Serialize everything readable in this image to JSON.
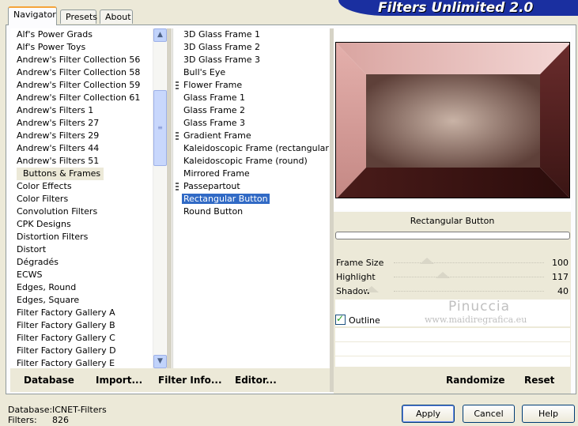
{
  "tabs": [
    {
      "label": "Navigator"
    },
    {
      "label": "Presets"
    },
    {
      "label": "About"
    }
  ],
  "banner": "Filters Unlimited 2.0",
  "categories": [
    "Alf's Power Grads",
    "Alf's Power Toys",
    "Andrew's Filter Collection 56",
    "Andrew's Filter Collection 58",
    "Andrew's Filter Collection 59",
    "Andrew's Filter Collection 61",
    "Andrew's Filters 1",
    "Andrew's Filters 27",
    "Andrew's Filters 29",
    "Andrew's Filters 44",
    "Andrew's Filters 51",
    "Buttons & Frames",
    "Color Effects",
    "Color Filters",
    "Convolution Filters",
    "CPK Designs",
    "Distortion Filters",
    "Distort",
    "Dégradés",
    "ECWS",
    "Edges, Round",
    "Edges, Square",
    "Filter Factory Gallery A",
    "Filter Factory Gallery B",
    "Filter Factory Gallery C",
    "Filter Factory Gallery D",
    "Filter Factory Gallery E"
  ],
  "filters": [
    {
      "label": "3D Glass Frame 1",
      "marked": false
    },
    {
      "label": "3D Glass Frame 2",
      "marked": false
    },
    {
      "label": "3D Glass Frame 3",
      "marked": false
    },
    {
      "label": "Bull's Eye",
      "marked": false
    },
    {
      "label": "Flower Frame",
      "marked": true
    },
    {
      "label": "Glass Frame 1",
      "marked": false
    },
    {
      "label": "Glass Frame 2",
      "marked": false
    },
    {
      "label": "Glass Frame 3",
      "marked": false
    },
    {
      "label": "Gradient Frame",
      "marked": true
    },
    {
      "label": "Kaleidoscopic Frame (rectangular)",
      "marked": false
    },
    {
      "label": "Kaleidoscopic Frame (round)",
      "marked": false
    },
    {
      "label": "Mirrored Frame",
      "marked": false
    },
    {
      "label": "Passepartout",
      "marked": true
    },
    {
      "label": "Rectangular Button",
      "marked": false
    },
    {
      "label": "Round Button",
      "marked": false
    }
  ],
  "filter_title": "Rectangular Button",
  "params": [
    {
      "label": "Frame Size",
      "value": "100",
      "level": 100
    },
    {
      "label": "Highlight",
      "value": "117",
      "level": 117
    },
    {
      "label": "Shadow",
      "value": "40",
      "level": 40
    }
  ],
  "outline_label": "Outline",
  "watermark": {
    "name": "Pinuccia",
    "url": "www.maidiregrafica.eu"
  },
  "bottom_links": {
    "database": "Database",
    "import": "Import...",
    "filter_info": "Filter Info...",
    "editor": "Editor...",
    "randomize": "Randomize",
    "reset": "Reset"
  },
  "buttons": {
    "apply": "Apply",
    "cancel": "Cancel",
    "help": "Help"
  },
  "status": {
    "database_label": "Database:",
    "database_value": "ICNET-Filters",
    "filters_label": "Filters:",
    "filters_value": "826"
  },
  "colors": {
    "selection": "#316ac5",
    "banner": "#1a2fa0"
  }
}
